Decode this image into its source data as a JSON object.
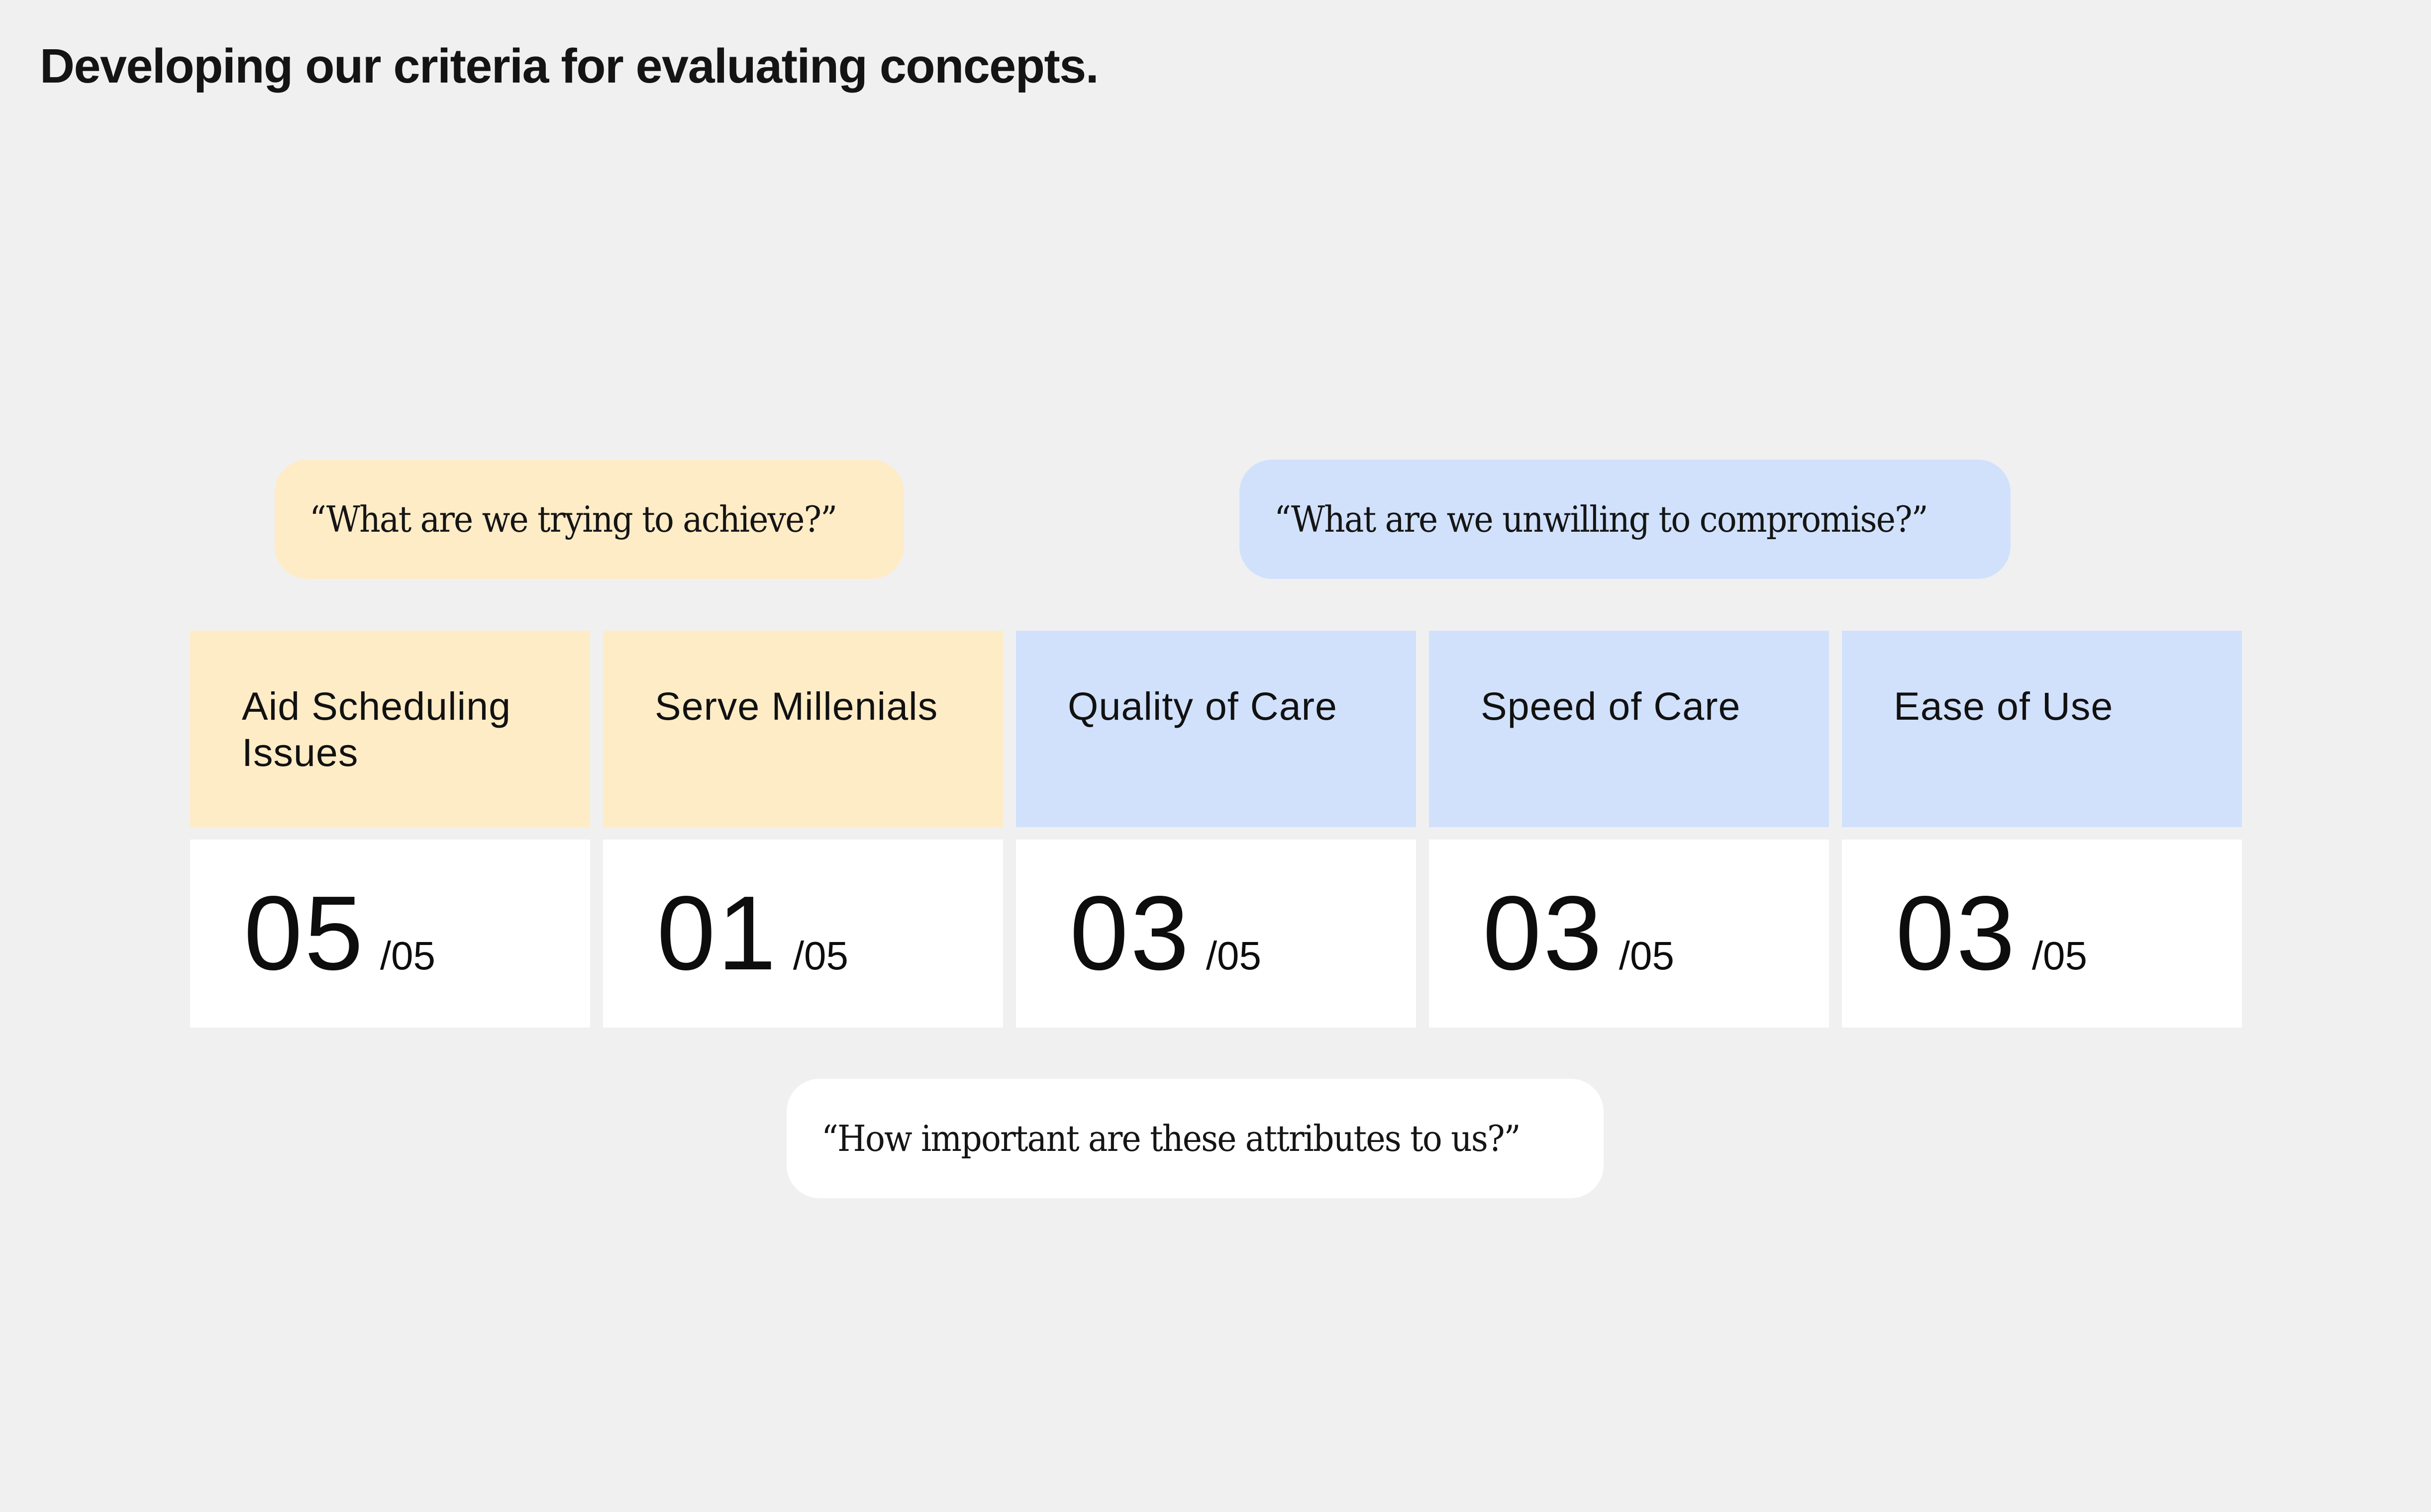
{
  "title": "Developing our criteria for evaluating concepts.",
  "prompts": {
    "achieve": "“What are we trying to achieve?”",
    "compromise": "“What are we unwilling to compromise?”",
    "importance": "“How important are these attributes to us?”"
  },
  "colors": {
    "background": "#f0f0f0",
    "achieve": "#feecc6",
    "compromise": "#d1e1fc",
    "value_card": "#ffffff",
    "text": "#111111"
  },
  "criteria": [
    {
      "label": "Aid Scheduling Issues",
      "group": "achieve",
      "score": "05",
      "max": "/05"
    },
    {
      "label": "Serve Millenials",
      "group": "achieve",
      "score": "01",
      "max": "/05"
    },
    {
      "label": "Quality of Care",
      "group": "compromise",
      "score": "03",
      "max": "/05"
    },
    {
      "label": "Speed of Care",
      "group": "compromise",
      "score": "03",
      "max": "/05"
    },
    {
      "label": "Ease of Use",
      "group": "compromise",
      "score": "03",
      "max": "/05"
    }
  ]
}
